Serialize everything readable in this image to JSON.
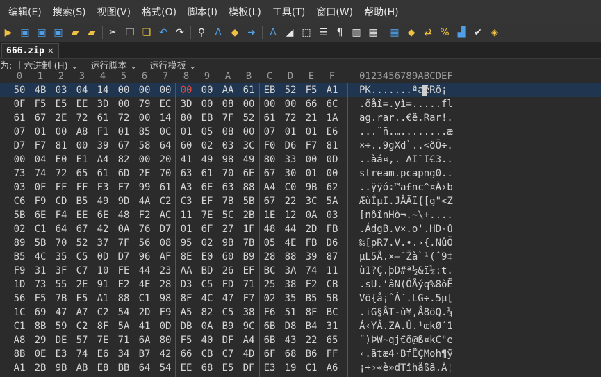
{
  "menu": [
    "编辑(E)",
    "搜索(S)",
    "视图(V)",
    "格式(O)",
    "脚本(I)",
    "模板(L)",
    "工具(T)",
    "窗口(W)",
    "帮助(H)"
  ],
  "tab": {
    "label": "666.zip",
    "close": "×"
  },
  "infobar": {
    "edit_as": "为: 十六进制 (H) ⌄",
    "run_script": "运行脚本 ⌄",
    "run_template": "运行模板 ⌄"
  },
  "ruler": {
    "cols": [
      "0",
      "1",
      "2",
      "3",
      "4",
      "5",
      "6",
      "7",
      "8",
      "9",
      "A",
      "B",
      "C",
      "D",
      "E",
      "F"
    ],
    "ascii_header": "0123456789ABCDEF"
  },
  "rows": [
    {
      "hex": [
        "50",
        "4B",
        "03",
        "04",
        "14",
        "00",
        "00",
        "00",
        "00",
        "00",
        "AA",
        "61",
        "EB",
        "52",
        "F5",
        "A1"
      ],
      "ascii": "PK.......ªaëRõ¡"
    },
    {
      "hex": [
        "0F",
        "F5",
        "E5",
        "EE",
        "3D",
        "00",
        "79",
        "EC",
        "3D",
        "00",
        "08",
        "00",
        "00",
        "00",
        "66",
        "6C"
      ],
      "ascii": ".õåî=.yì=.....fl"
    },
    {
      "hex": [
        "61",
        "67",
        "2E",
        "72",
        "61",
        "72",
        "00",
        "14",
        "80",
        "EB",
        "7F",
        "52",
        "61",
        "72",
        "21",
        "1A"
      ],
      "ascii": "ag.rar..€ë.Rar!."
    },
    {
      "hex": [
        "07",
        "01",
        "00",
        "A8",
        "F1",
        "01",
        "85",
        "0C",
        "01",
        "05",
        "08",
        "00",
        "07",
        "01",
        "01",
        "E6"
      ],
      "ascii": "...¨ñ.…........æ"
    },
    {
      "hex": [
        "D7",
        "F7",
        "81",
        "00",
        "39",
        "67",
        "58",
        "64",
        "60",
        "02",
        "03",
        "3C",
        "F0",
        "D6",
        "F7",
        "81"
      ],
      "ascii": "×÷..9gXd`..<ðÖ÷."
    },
    {
      "hex": [
        "00",
        "04",
        "E0",
        "E1",
        "A4",
        "82",
        "00",
        "20",
        "41",
        "49",
        "98",
        "49",
        "80",
        "33",
        "00",
        "0D"
      ],
      "ascii": "..àá¤‚. AI˜I€3.."
    },
    {
      "hex": [
        "73",
        "74",
        "72",
        "65",
        "61",
        "6D",
        "2E",
        "70",
        "63",
        "61",
        "70",
        "6E",
        "67",
        "30",
        "01",
        "00"
      ],
      "ascii": "stream.pcapng0.."
    },
    {
      "hex": [
        "03",
        "0F",
        "FF",
        "FF",
        "F3",
        "F7",
        "99",
        "61",
        "A3",
        "6E",
        "63",
        "88",
        "A4",
        "C0",
        "9B",
        "62"
      ],
      "ascii": "..ÿÿó÷™a£nc^¤À›b"
    },
    {
      "hex": [
        "C6",
        "F9",
        "CD",
        "B5",
        "49",
        "9D",
        "4A",
        "C2",
        "C3",
        "EF",
        "7B",
        "5B",
        "67",
        "22",
        "3C",
        "5A"
      ],
      "ascii": "ÆùÍµI.JÂÃï{[g\"<Z"
    },
    {
      "hex": [
        "5B",
        "6E",
        "F4",
        "EE",
        "6E",
        "48",
        "F2",
        "AC",
        "11",
        "7E",
        "5C",
        "2B",
        "1E",
        "12",
        "0A",
        "03"
      ],
      "ascii": "[nôînHò¬.~\\+...."
    },
    {
      "hex": [
        "02",
        "C1",
        "64",
        "67",
        "42",
        "0A",
        "76",
        "D7",
        "01",
        "6F",
        "27",
        "1F",
        "48",
        "44",
        "2D",
        "FB"
      ],
      "ascii": ".ÁdgB.v×.o'.HD-û"
    },
    {
      "hex": [
        "89",
        "5B",
        "70",
        "52",
        "37",
        "7F",
        "56",
        "08",
        "95",
        "02",
        "9B",
        "7B",
        "05",
        "4E",
        "FB",
        "D6"
      ],
      "ascii": "‰[pR7.V.•.›{.NûÖ"
    },
    {
      "hex": [
        "B5",
        "4C",
        "35",
        "C5",
        "0D",
        "D7",
        "96",
        "AF",
        "8E",
        "E0",
        "60",
        "B9",
        "28",
        "88",
        "39",
        "87"
      ],
      "ascii": "µL5Å.×–¯Žà`¹(ˆ9‡"
    },
    {
      "hex": [
        "F9",
        "31",
        "3F",
        "C7",
        "10",
        "FE",
        "44",
        "23",
        "AA",
        "BD",
        "26",
        "EF",
        "BC",
        "3A",
        "74",
        "11"
      ],
      "ascii": "ù1?Ç.þD#ª½&ï¼:t."
    },
    {
      "hex": [
        "1D",
        "73",
        "55",
        "2E",
        "91",
        "E2",
        "4E",
        "28",
        "D3",
        "C5",
        "FD",
        "71",
        "25",
        "38",
        "F2",
        "CB"
      ],
      "ascii": ".sU.‘âN(ÓÅýq%8òË"
    },
    {
      "hex": [
        "56",
        "F5",
        "7B",
        "E5",
        "A1",
        "88",
        "C1",
        "98",
        "8F",
        "4C",
        "47",
        "F7",
        "02",
        "35",
        "B5",
        "5B"
      ],
      "ascii": "Võ{å¡ˆÁ˜.LG÷.5µ["
    },
    {
      "hex": [
        "1C",
        "69",
        "47",
        "A7",
        "C2",
        "54",
        "2D",
        "F9",
        "A5",
        "82",
        "C5",
        "38",
        "F6",
        "51",
        "8F",
        "BC"
      ],
      "ascii": ".iG§ÂT-ù¥‚Å8öQ.¼"
    },
    {
      "hex": [
        "C1",
        "8B",
        "59",
        "C2",
        "8F",
        "5A",
        "41",
        "0D",
        "DB",
        "0A",
        "B9",
        "9C",
        "6B",
        "D8",
        "B4",
        "31"
      ],
      "ascii": "Á‹YÂ.ZA.Û.¹œkØ´1"
    },
    {
      "hex": [
        "A8",
        "29",
        "DE",
        "57",
        "7E",
        "71",
        "6A",
        "80",
        "F5",
        "40",
        "DF",
        "A4",
        "6B",
        "43",
        "22",
        "65"
      ],
      "ascii": "¨)ÞW~qj€õ@ß¤kC\"e"
    },
    {
      "hex": [
        "8B",
        "0E",
        "E3",
        "74",
        "E6",
        "34",
        "B7",
        "42",
        "66",
        "CB",
        "C7",
        "4D",
        "6F",
        "68",
        "B6",
        "FF"
      ],
      "ascii": "‹.ãtæ4·BfËÇMoh¶ÿ"
    },
    {
      "hex": [
        "A1",
        "2B",
        "9B",
        "AB",
        "E8",
        "BB",
        "64",
        "54",
        "EE",
        "68",
        "E5",
        "DF",
        "E3",
        "19",
        "C1",
        "A6"
      ],
      "ascii": "¡+›«è»dTîhåßã.Á¦"
    }
  ],
  "highlight": {
    "row": 0,
    "col": 8,
    "color": "#e04a3a"
  },
  "colors": {
    "background": "#2b2b2b",
    "selected_row": "#1f3550",
    "menubar": "#353535"
  }
}
